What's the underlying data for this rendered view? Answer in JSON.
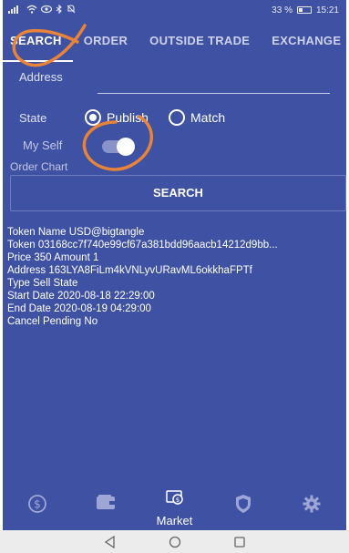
{
  "status": {
    "left_icons": [
      "signal-icon",
      "wifi-icon",
      "eye-icon",
      "bluetooth-icon",
      "mute-icon"
    ],
    "battery_text": "33 %",
    "time": "15:21"
  },
  "tabs": [
    {
      "label": "SEARCH",
      "active": true
    },
    {
      "label": "ORDER",
      "active": false
    },
    {
      "label": "OUTSIDE TRADE",
      "active": false
    },
    {
      "label": "EXCHANGE",
      "active": false
    }
  ],
  "form": {
    "address_label": "Address",
    "address_value": "",
    "state_label": "State",
    "state_options": [
      {
        "label": "Publish",
        "selected": true
      },
      {
        "label": "Match",
        "selected": false
      }
    ],
    "myself_label": "My Self",
    "myself_on": true,
    "order_chart_label": "Order Chart",
    "search_button": "SEARCH"
  },
  "result": {
    "lines": [
      "Token Name  USD@bigtangle",
      "Token  03168cc7f740e99cf67a381bdd96aacb14212d9bb...",
      "Price  350   Amount  1",
      "Address  163LYA8FiLm4kVNLyvURavML6okkhaFPTf",
      "Type  Sell    State",
      "Start Date  2020-08-18 22:29:00",
      "End Date  2020-08-19 04:29:00",
      "Cancel Pending  No"
    ]
  },
  "bottom_nav": [
    {
      "icon": "dollar-icon",
      "label": "",
      "active": false
    },
    {
      "icon": "wallet-icon",
      "label": "",
      "active": false
    },
    {
      "icon": "market-icon",
      "label": "Market",
      "active": true
    },
    {
      "icon": "shield-icon",
      "label": "",
      "active": false
    },
    {
      "icon": "gear-icon",
      "label": "",
      "active": false
    }
  ],
  "system_nav": [
    "back-icon",
    "home-icon",
    "recents-icon"
  ],
  "colors": {
    "app_background": "#3f51a3",
    "annotation": "#e8833a",
    "system_bar": "#ececec"
  }
}
